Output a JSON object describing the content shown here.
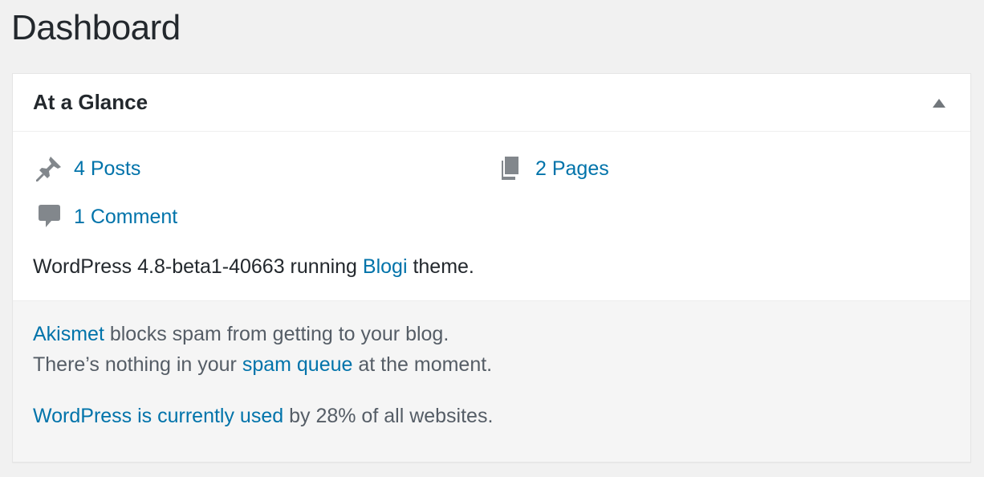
{
  "page": {
    "title": "Dashboard"
  },
  "widget": {
    "title": "At a Glance",
    "toggle_icon": "triangle-up-icon",
    "items": {
      "posts": {
        "label": "4 Posts",
        "icon": "pushpin-icon"
      },
      "pages": {
        "label": "2 Pages",
        "icon": "pages-icon"
      },
      "comments": {
        "label": "1 Comment",
        "icon": "speech-bubble-icon"
      }
    },
    "version": {
      "prefix": "WordPress 4.8-beta1-40663 running ",
      "theme_link": "Blogi",
      "suffix": " theme."
    },
    "akismet": {
      "line1_link": "Akismet",
      "line1_text": " blocks spam from getting to your blog.",
      "line2_prefix": "There’s nothing in your ",
      "line2_link": "spam queue",
      "line2_suffix": " at the moment."
    },
    "usage": {
      "link": "WordPress is currently used",
      "text": " by 28% of all websites."
    }
  },
  "colors": {
    "link": "#0073aa",
    "text": "#23282d",
    "icon": "#82878c",
    "background": "#f1f1f1"
  }
}
